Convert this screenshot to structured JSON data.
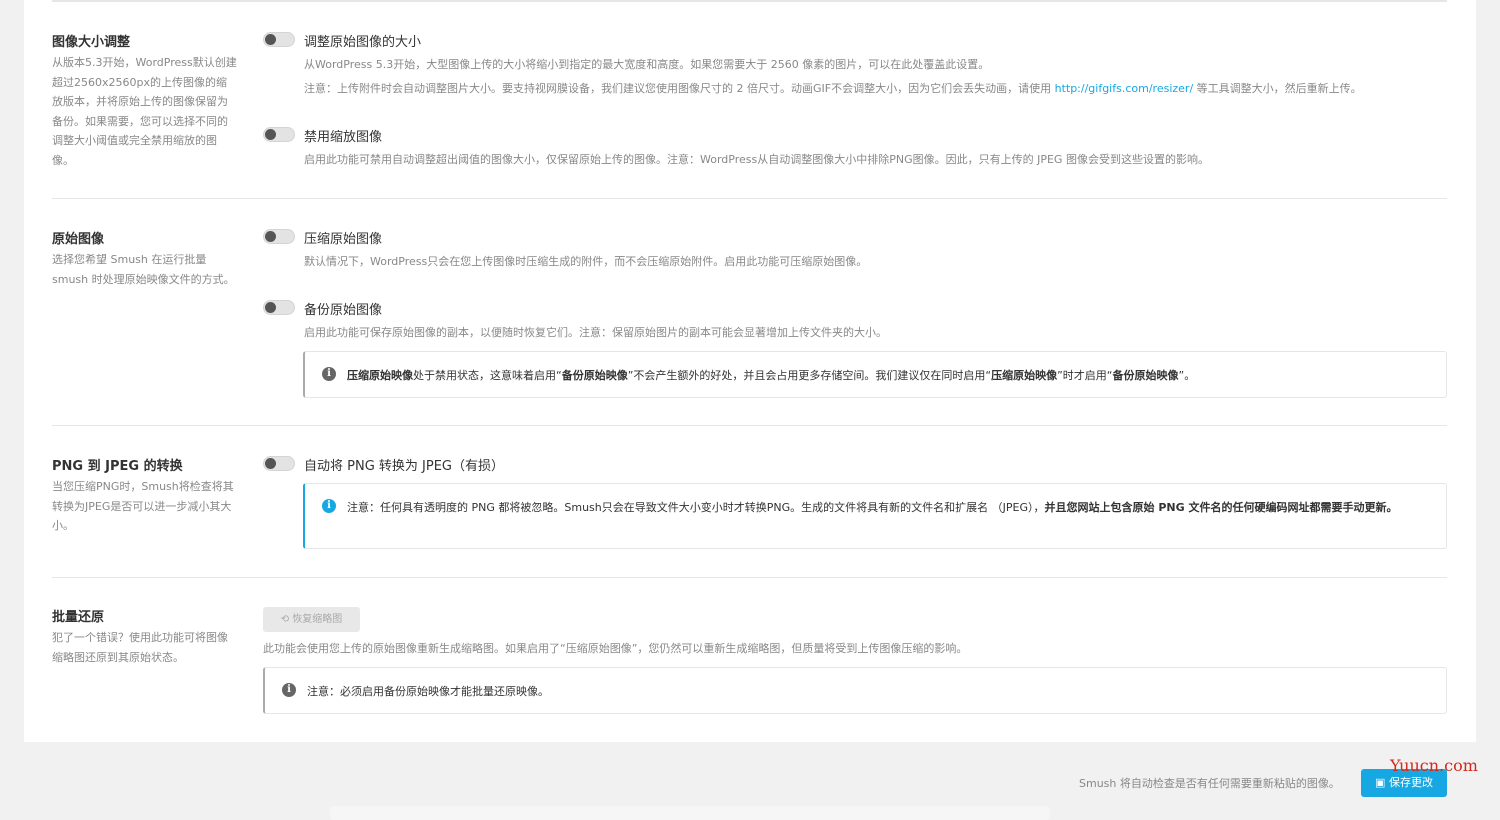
{
  "colors": {
    "accent": "#17a8e3",
    "background": "#f1f1f1",
    "panel": "#ffffff",
    "muted_text": "#888888"
  },
  "sections": {
    "resize": {
      "title": "图像大小调整",
      "desc": "从版本5.3开始，WordPress默认创建超过2560x2560px的上传图像的缩放版本，并将原始上传的图像保留为备份。如果需要，您可以选择不同的调整大小阈值或完全禁用缩放的图像。",
      "opt1_label": "调整原始图像的大小",
      "opt1_desc": "从WordPress 5.3开始，大型图像上传的大小将缩小到指定的最大宽度和高度。如果您需要大于 2560 像素的图片，可以在此处覆盖此设置。",
      "opt1_note_pre": "注意：上传附件时会自动调整图片大小。要支持视网膜设备，我们建议您使用图像尺寸的 2 倍尺寸。动画GIF不会调整大小，因为它们会丢失动画，请使用",
      "opt1_note_link": "http://gifgifs.com/resizer/",
      "opt1_note_post": "等工具调整大小，然后重新上传。",
      "opt2_label": "禁用缩放图像",
      "opt2_desc": "启用此功能可禁用自动调整超出阈值的图像大小，仅保留原始上传的图像。注意：WordPress从自动调整图像大小中排除PNG图像。因此，只有上传的 JPEG 图像会受到这些设置的影响。"
    },
    "original": {
      "title": "原始图像",
      "desc": "选择您希望 Smush 在运行批量 smush 时处理原始映像文件的方式。",
      "opt1_label": "压缩原始图像",
      "opt1_desc": "默认情况下，WordPress只会在您上传图像时压缩生成的附件，而不会压缩原始附件。启用此功能可压缩原始图像。",
      "opt2_label": "备份原始图像",
      "opt2_desc": "启用此功能可保存原始图像的副本，以便随时恢复它们。注意：保留原始图片的副本可能会显著增加上传文件夹的大小。",
      "notice": {
        "p1": "压缩原始映像",
        "p2": "处于禁用状态，这意味着启用“",
        "p3": "备份原始映像",
        "p4": "”不会产生额外的好处，并且会占用更多存储空间。我们建议仅在同时启用“",
        "p5": "压缩原始映像",
        "p6": "”时才启用“",
        "p7": "备份原始映像",
        "p8": "”。"
      }
    },
    "png": {
      "title": "PNG 到 JPEG 的转换",
      "desc": "当您压缩PNG时，Smush将检查将其转换为JPEG是否可以进一步减小其大小。",
      "opt1_label": "自动将 PNG 转换为 JPEG（有损）",
      "notice_plain": "注意：任何具有透明度的 PNG 都将被忽略。Smush只会在导致文件大小变小时才转换PNG。生成的文件将具有新的文件名和扩展名 （JPEG），",
      "notice_bold": "并且您网站上包含原始 PNG 文件名的任何硬编码网址都需要手动更新。"
    },
    "bulk": {
      "title": "批量还原",
      "desc": "犯了一个错误？使用此功能可将图像缩略图还原到其原始状态。",
      "button": "恢复缩略图",
      "desc2": "此功能会使用您上传的原始图像重新生成缩略图。如果启用了“压缩原始图像”，您仍然可以重新生成缩略图，但质量将受到上传图像压缩的影响。",
      "notice": "注意：必须启用备份原始映像才能批量还原映像。"
    }
  },
  "footer": {
    "note": "Smush 将自动检查是否有任何需要重新粘贴的图像。",
    "save": "保存更改",
    "save_icon": "floppy-icon",
    "restore_icon": "undo-icon"
  },
  "watermark": "Yuucn.com",
  "icons": {
    "info": "info-icon",
    "toggle_off": "toggle-off"
  }
}
